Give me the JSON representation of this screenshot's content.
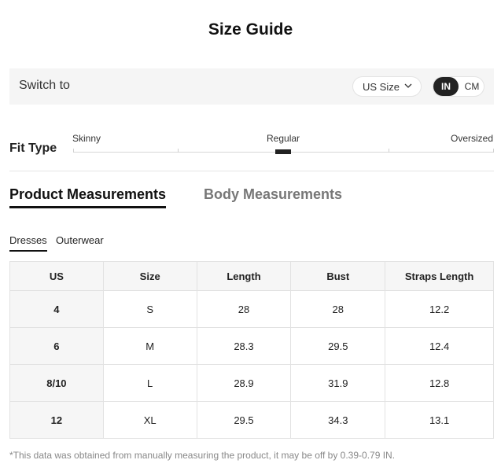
{
  "title": "Size Guide",
  "switch": {
    "label": "Switch to",
    "size_select": {
      "value": "US Size",
      "icon": "chevron-down-icon"
    },
    "units": {
      "active": "IN",
      "inactive": "CM"
    }
  },
  "fit": {
    "label": "Fit Type",
    "options": [
      "Skinny",
      "Regular",
      "Oversized"
    ],
    "selected": "Regular"
  },
  "tabs": {
    "product": "Product Measurements",
    "body": "Body Measurements",
    "active": "Product Measurements"
  },
  "subtabs": {
    "items": [
      "Dresses",
      "Outerwear"
    ],
    "active": "Dresses"
  },
  "table": {
    "headers": [
      "US",
      "Size",
      "Length",
      "Bust",
      "Straps Length"
    ],
    "rows": [
      [
        "4",
        "S",
        "28",
        "28",
        "12.2"
      ],
      [
        "6",
        "M",
        "28.3",
        "29.5",
        "12.4"
      ],
      [
        "8/10",
        "L",
        "28.9",
        "31.9",
        "12.8"
      ],
      [
        "12",
        "XL",
        "29.5",
        "34.3",
        "13.1"
      ]
    ]
  },
  "footnote": "*This data was obtained from manually measuring the product, it may be off by 0.39-0.79 IN.",
  "colors": {
    "accent": "#222222",
    "panel": "#f5f5f5",
    "muted_text": "#888888"
  }
}
